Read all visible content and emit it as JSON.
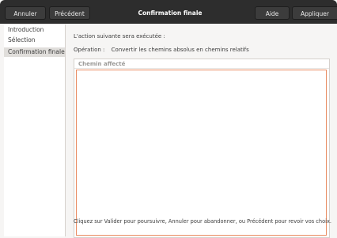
{
  "titlebar": {
    "cancel_label": "Annuler",
    "previous_label": "Précédent",
    "title": "Confirmation finale",
    "help_label": "Aide",
    "apply_label": "Appliquer"
  },
  "sidebar": {
    "items": [
      {
        "label": "Introduction"
      },
      {
        "label": "Sélection"
      },
      {
        "label": "Confirmation finale"
      }
    ]
  },
  "main": {
    "intro_text": "L'action suivante sera exécutée :",
    "operation_label": "Opération :",
    "operation_value": "Convertir les chemins absolus en chemins relatifs",
    "list_header": "Chemin affecté",
    "footer_text": "Cliquez sur Valider pour poursuivre, Annuler pour abandonner, ou Précédent pour revoir vos choix."
  }
}
